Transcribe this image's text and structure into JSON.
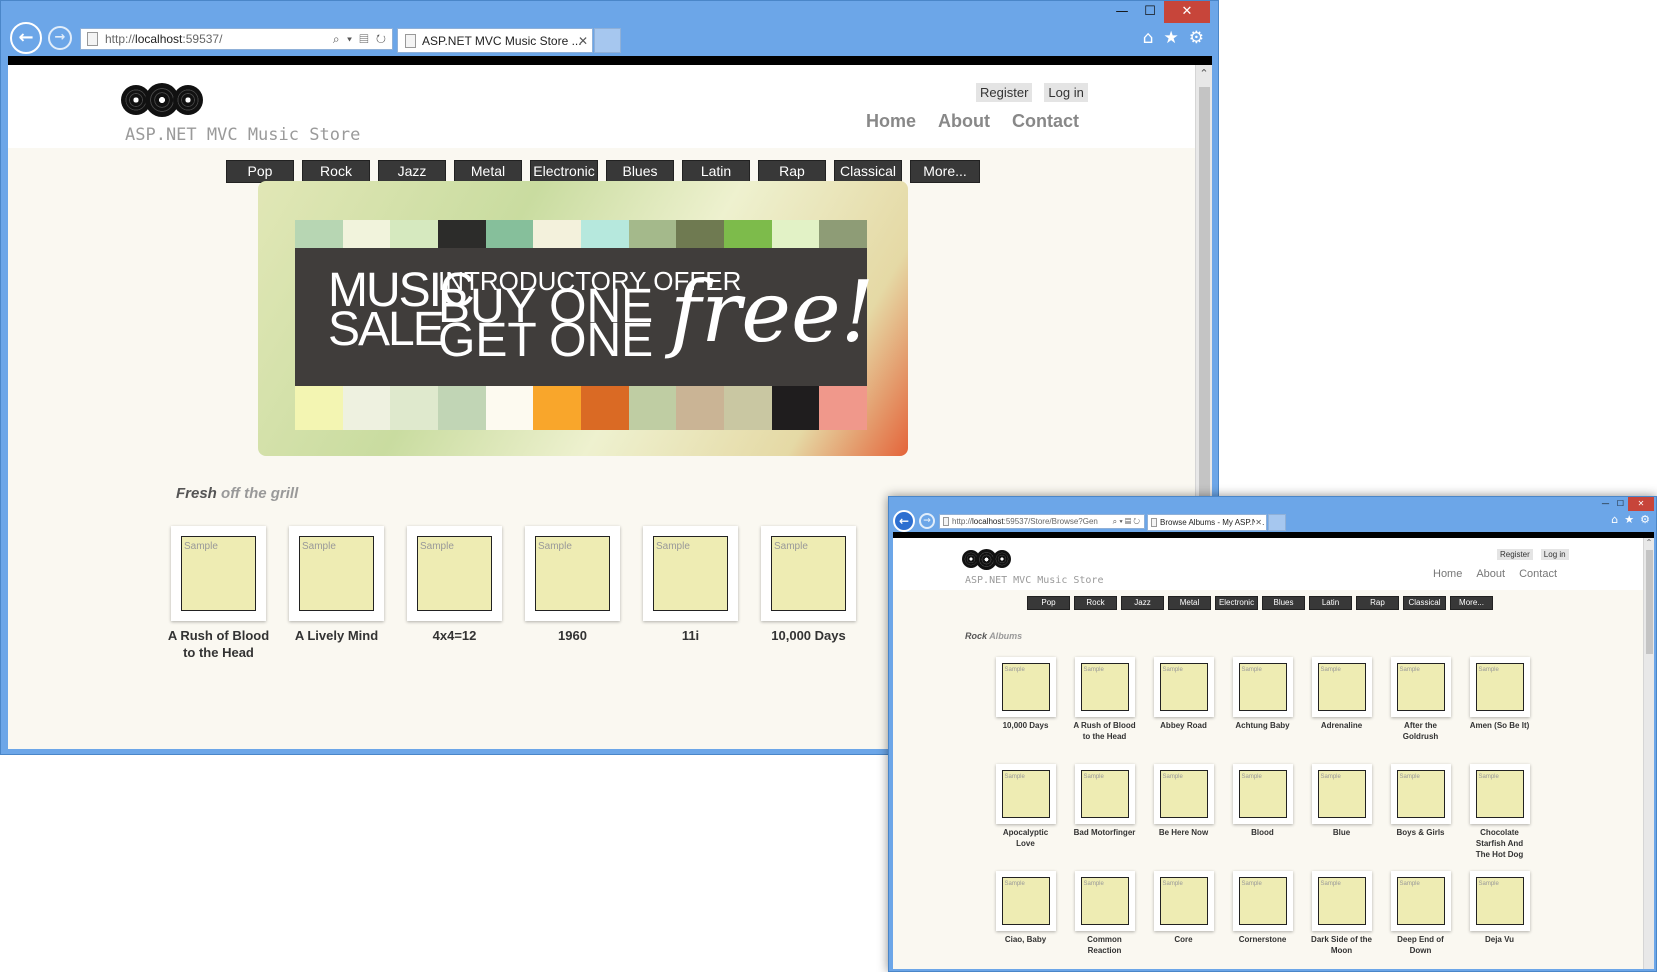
{
  "window1": {
    "address": {
      "prefix": "http://",
      "host": "localhost",
      "suffix": ":59537/"
    },
    "tab_title": "ASP.NET MVC Music Store ...",
    "window_controls": {
      "min": "—",
      "max": "☐",
      "close": "✕"
    },
    "site_title": "ASP.NET MVC Music Store",
    "auth": {
      "register": "Register",
      "login": "Log in"
    },
    "menu": {
      "home": "Home",
      "about": "About",
      "contact": "Contact"
    },
    "genres": [
      "Pop",
      "Rock",
      "Jazz",
      "Metal",
      "Electronic",
      "Blues",
      "Latin",
      "Rap",
      "Classical",
      "More..."
    ],
    "banner": {
      "music": "MUSIC",
      "sale": "SALE",
      "offer": "INTRODUCTORY OFFER",
      "buy": "BUY ONE",
      "get": "GET ONE",
      "free": "free!"
    },
    "section": {
      "a": "Fresh",
      "b": "off the grill"
    },
    "albums": [
      {
        "title": "A Rush of Blood to the Head"
      },
      {
        "title": "A Lively Mind"
      },
      {
        "title": "4x4=12"
      },
      {
        "title": "1960"
      },
      {
        "title": "11i"
      },
      {
        "title": "10,000 Days"
      }
    ],
    "sample_label": "Sample"
  },
  "window2": {
    "address": {
      "prefix": "http://",
      "host": "localhost",
      "suffix": ":59537/Store/Browse?Gen"
    },
    "tab_title": "Browse Albums - My ASP.N...",
    "site_title": "ASP.NET MVC Music Store",
    "auth": {
      "register": "Register",
      "login": "Log in"
    },
    "menu": {
      "home": "Home",
      "about": "About",
      "contact": "Contact"
    },
    "genres": [
      "Pop",
      "Rock",
      "Jazz",
      "Metal",
      "Electronic",
      "Blues",
      "Latin",
      "Rap",
      "Classical",
      "More..."
    ],
    "section": {
      "a": "Rock",
      "b": "Albums"
    },
    "albums": [
      {
        "title": "10,000 Days"
      },
      {
        "title": "A Rush of Blood to the Head"
      },
      {
        "title": "Abbey Road"
      },
      {
        "title": "Achtung Baby"
      },
      {
        "title": "Adrenaline"
      },
      {
        "title": "After the Goldrush"
      },
      {
        "title": "Amen (So Be It)"
      },
      {
        "title": "Apocalyptic Love"
      },
      {
        "title": "Bad Motorfinger"
      },
      {
        "title": "Be Here Now"
      },
      {
        "title": "Blood"
      },
      {
        "title": "Blue"
      },
      {
        "title": "Boys & Girls"
      },
      {
        "title": "Chocolate Starfish And The Hot Dog Flavored Water"
      },
      {
        "title": "Ciao, Baby"
      },
      {
        "title": "Common Reaction"
      },
      {
        "title": "Core"
      },
      {
        "title": "Cornerstone"
      },
      {
        "title": "Dark Side of the Moon"
      },
      {
        "title": "Deep End of Down"
      },
      {
        "title": "Deja Vu"
      }
    ],
    "sample_label": "Sample"
  },
  "colors": {
    "chrome": "#6ca6e8",
    "genre_bg": "#383838",
    "close": "#c7453a",
    "art": "#eeecb3"
  }
}
